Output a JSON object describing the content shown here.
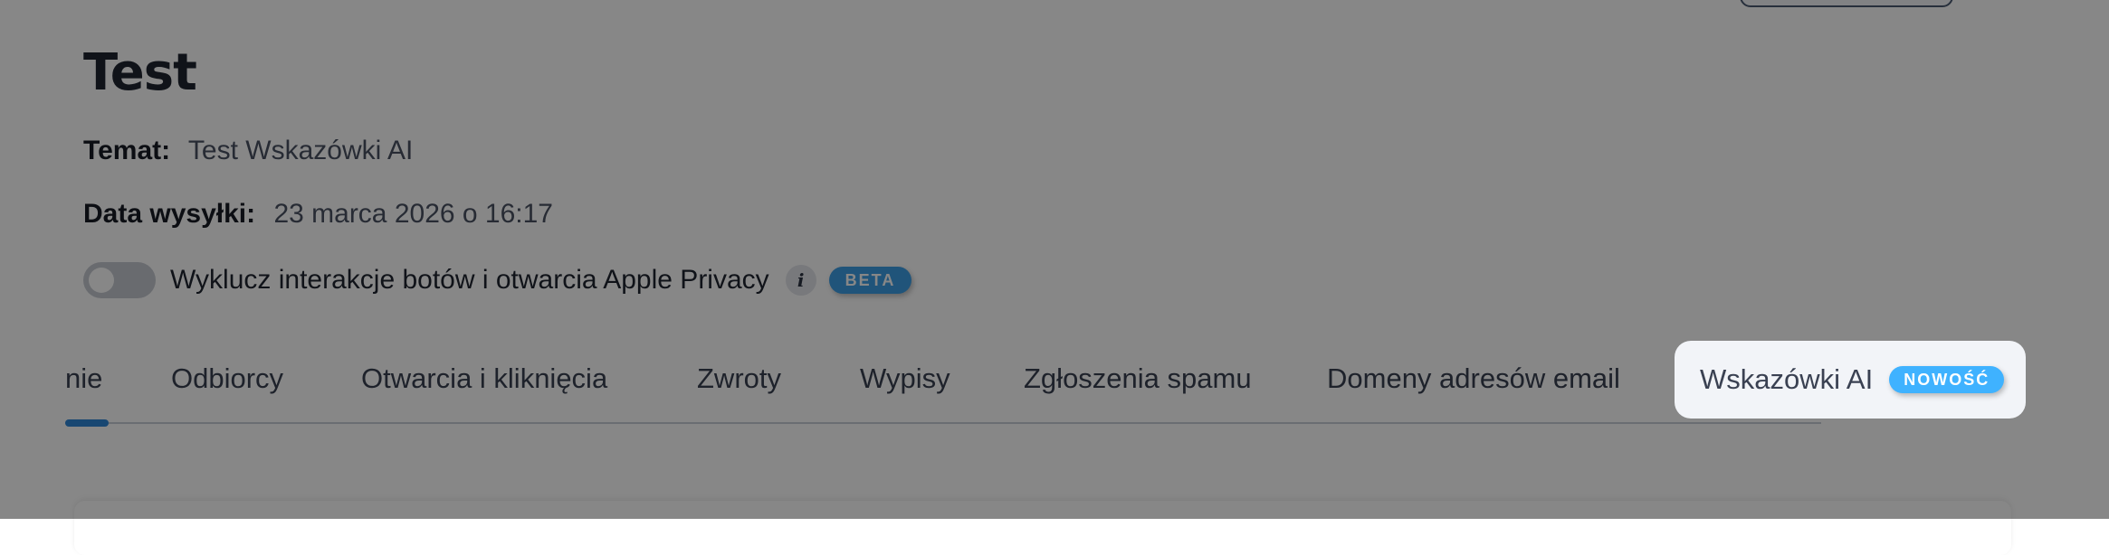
{
  "campaign": {
    "title": "Test",
    "subject_label": "Temat:",
    "subject_value": "Test Wskazówki AI",
    "date_label": "Data wysyłki:",
    "date_value": "23 marca 2026 o 16:17"
  },
  "toggle": {
    "label": "Wyklucz interakcje botów i otwarcia Apple Privacy",
    "state": "off",
    "info_icon": "info-icon",
    "badge": "BETA"
  },
  "tabs": [
    {
      "label": "nie"
    },
    {
      "label": "Odbiorcy"
    },
    {
      "label": "Otwarcia i kliknięcia"
    },
    {
      "label": "Zwroty"
    },
    {
      "label": "Wypisy"
    },
    {
      "label": "Zgłoszenia spamu"
    },
    {
      "label": "Domeny adresów email"
    }
  ],
  "highlighted_tab": {
    "label": "Wskazówki AI",
    "badge": "NOWOŚĆ"
  },
  "colors": {
    "overlay": "#000000",
    "beta_badge": "#3d9fe6",
    "new_badge": "#3fb2ff",
    "active_tab_indicator": "#2f86d8"
  }
}
